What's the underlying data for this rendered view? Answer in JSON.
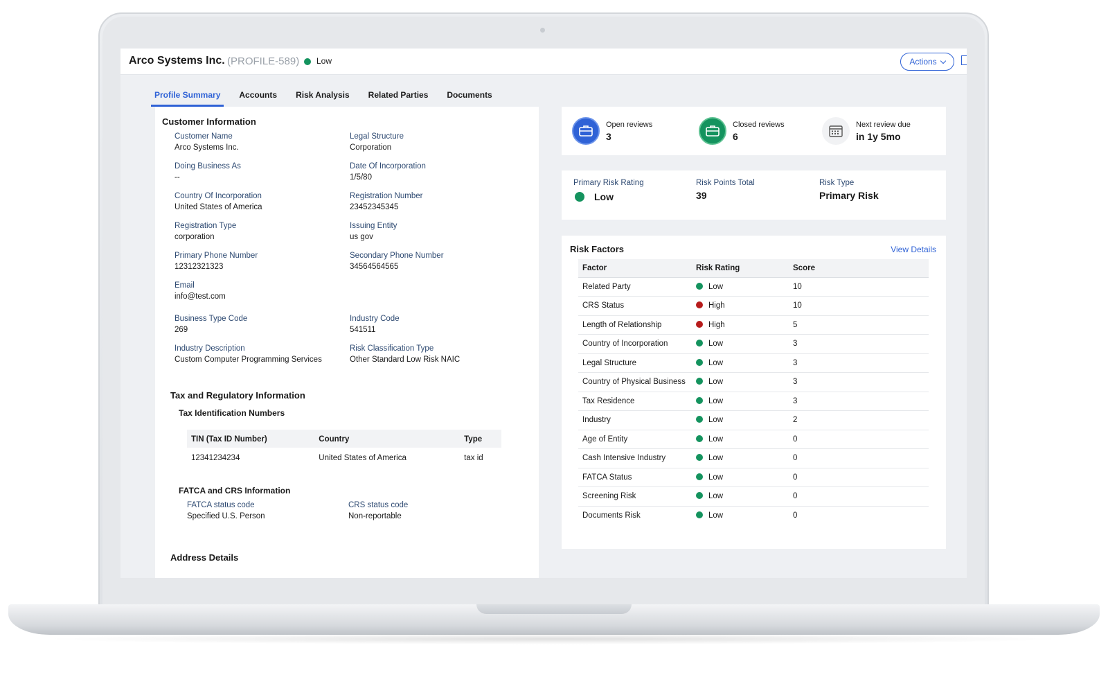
{
  "header": {
    "title": "Arco Systems Inc.",
    "profile_id": "(PROFILE-589)",
    "risk_level": "Low",
    "risk_color": "#14935e",
    "actions_label": "Actions"
  },
  "tabs": [
    {
      "label": "Profile Summary",
      "active": true
    },
    {
      "label": "Accounts",
      "active": false
    },
    {
      "label": "Risk Analysis",
      "active": false
    },
    {
      "label": "Related Parties",
      "active": false
    },
    {
      "label": "Documents",
      "active": false
    }
  ],
  "customer_info": {
    "title": "Customer Information",
    "fields": {
      "customer_name": {
        "label": "Customer Name",
        "value": "Arco Systems Inc."
      },
      "legal_structure": {
        "label": "Legal Structure",
        "value": "Corporation"
      },
      "doing_business_as": {
        "label": "Doing Business As",
        "value": "--"
      },
      "date_of_incorporation": {
        "label": "Date Of Incorporation",
        "value": "1/5/80"
      },
      "country_of_incorporation": {
        "label": "Country Of Incorporation",
        "value": "United States of America"
      },
      "registration_number": {
        "label": "Registration Number",
        "value": "23452345345"
      },
      "registration_type": {
        "label": "Registration Type",
        "value": "corporation"
      },
      "issuing_entity": {
        "label": "Issuing Entity",
        "value": "us gov"
      },
      "primary_phone": {
        "label": "Primary Phone Number",
        "value": "12312321323"
      },
      "secondary_phone": {
        "label": "Secondary Phone Number",
        "value": "34564564565"
      },
      "email": {
        "label": "Email",
        "value": "info@test.com"
      },
      "business_type_code": {
        "label": "Business Type Code",
        "value": "269"
      },
      "industry_code": {
        "label": "Industry Code",
        "value": "541511"
      },
      "industry_description": {
        "label": "Industry Description",
        "value": "Custom Computer Programming Services"
      },
      "risk_classification_type": {
        "label": "Risk Classification Type",
        "value": "Other Standard Low Risk NAIC"
      }
    }
  },
  "tax_info": {
    "title": "Tax and Regulatory Information",
    "tin_title": "Tax Identification Numbers",
    "tin_headers": [
      "TIN (Tax ID Number)",
      "Country",
      "Type"
    ],
    "tin_rows": [
      [
        "12341234234",
        "United States of America",
        "tax id"
      ]
    ],
    "fatca_title": "FATCA and CRS Information",
    "fatca_status": {
      "label": "FATCA status code",
      "value": "Specified U.S. Person"
    },
    "crs_status": {
      "label": "CRS status code",
      "value": "Non-reportable"
    }
  },
  "address": {
    "title": "Address Details"
  },
  "reviews": {
    "open": {
      "label": "Open reviews",
      "value": "3",
      "color": "#2f62d6"
    },
    "closed": {
      "label": "Closed reviews",
      "value": "6",
      "color": "#14935e"
    },
    "next_due": {
      "label": "Next review due",
      "value": "in 1y 5mo"
    }
  },
  "risk_summary": {
    "primary_rating": {
      "label": "Primary Risk Rating",
      "value": "Low"
    },
    "points_total": {
      "label": "Risk Points Total",
      "value": "39"
    },
    "risk_type": {
      "label": "Risk Type",
      "value": "Primary Risk"
    }
  },
  "risk_factors": {
    "title": "Risk Factors",
    "view_details": "View Details",
    "headers": [
      "Factor",
      "Risk Rating",
      "Score"
    ],
    "colors": {
      "Low": "#14935e",
      "High": "#b71c1c"
    },
    "rows": [
      {
        "factor": "Related Party",
        "rating": "Low",
        "score": "10"
      },
      {
        "factor": "CRS Status",
        "rating": "High",
        "score": "10"
      },
      {
        "factor": "Length of Relationship",
        "rating": "High",
        "score": "5"
      },
      {
        "factor": "Country of Incorporation",
        "rating": "Low",
        "score": "3"
      },
      {
        "factor": "Legal Structure",
        "rating": "Low",
        "score": "3"
      },
      {
        "factor": "Country of Physical Business",
        "rating": "Low",
        "score": "3"
      },
      {
        "factor": "Tax Residence",
        "rating": "Low",
        "score": "3"
      },
      {
        "factor": "Industry",
        "rating": "Low",
        "score": "2"
      },
      {
        "factor": "Age of Entity",
        "rating": "Low",
        "score": "0"
      },
      {
        "factor": "Cash Intensive Industry",
        "rating": "Low",
        "score": "0"
      },
      {
        "factor": "FATCA Status",
        "rating": "Low",
        "score": "0"
      },
      {
        "factor": "Screening Risk",
        "rating": "Low",
        "score": "0"
      },
      {
        "factor": "Documents Risk",
        "rating": "Low",
        "score": "0"
      }
    ]
  }
}
